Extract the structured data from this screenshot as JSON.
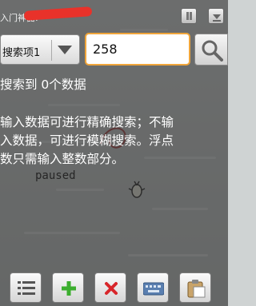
{
  "title_bar": {
    "app_title": "入门神器:"
  },
  "search": {
    "dropdown_label": "搜索项1",
    "input_value": "258"
  },
  "messages": {
    "result_count": "搜索到 0个数据",
    "help_lines": [
      "输入数据可进行精确搜索；不输",
      "入数据，可进行模糊搜索。浮点",
      "数只需输入整数部分。"
    ]
  },
  "background": {
    "paused_text": "paused"
  },
  "toolbar": {
    "icons": [
      "list-icon",
      "plus-icon",
      "close-icon",
      "keyboard-icon",
      "clipboard-icon"
    ]
  },
  "colors": {
    "input_border": "#f0a53a",
    "add": "#3cae2e",
    "delete": "#d8262a",
    "redaction": "#e8322a"
  }
}
